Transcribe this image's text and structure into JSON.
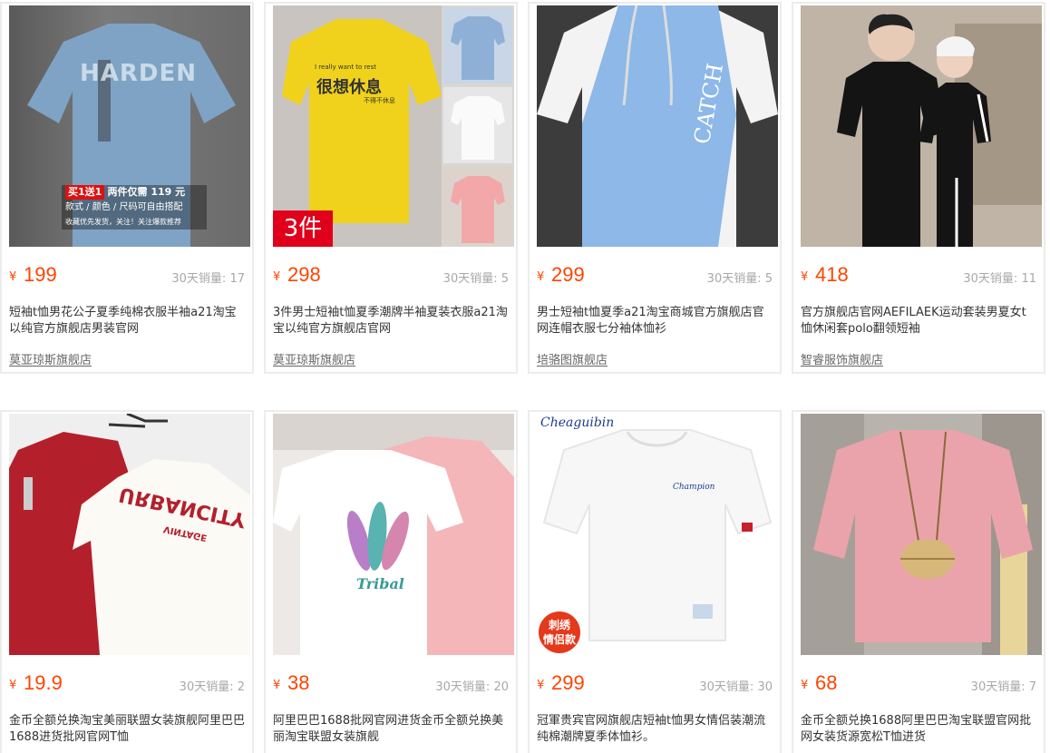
{
  "currency": "¥",
  "products": [
    {
      "price": "199",
      "sales": "30天销量: 17",
      "title": "短袖t恤男花公子夏季纯棉衣服半袖a21淘宝以纯官方旗舰店男装官网",
      "shop": "莫亚琼斯旗舰店"
    },
    {
      "price": "298",
      "sales": "30天销量: 5",
      "title": "3件男士短袖t恤夏季潮牌半袖夏装衣服a21淘宝以纯官方旗舰店官网",
      "shop": "莫亚琼斯旗舰店"
    },
    {
      "price": "299",
      "sales": "30天销量: 5",
      "title": "男士短袖t恤夏季a21淘宝商城官方旗舰店官网连帽衣服七分袖体恤衫",
      "shop": "培骆图旗舰店"
    },
    {
      "price": "418",
      "sales": "30天销量: 11",
      "title": "官方旗舰店官网AEFILAEK运动套装男夏女t恤休闲套polo翻领短袖",
      "shop": "智睿服饰旗舰店"
    },
    {
      "price": "19.9",
      "sales": "30天销量: 2",
      "title": "金币全额兑换淘宝美丽联盟女装旗舰阿里巴巴1688进货批网官网T恤",
      "shop": ""
    },
    {
      "price": "38",
      "sales": "30天销量: 20",
      "title": "阿里巴巴1688批网官网进货金币全额兑换美丽淘宝联盟女装旗舰",
      "shop": ""
    },
    {
      "price": "299",
      "sales": "30天销量: 30",
      "title": "冠軍贵宾官网旗舰店短袖t恤男女情侣装潮流纯棉潮牌夏季体恤衫。",
      "shop": ""
    },
    {
      "price": "68",
      "sales": "30天销量: 7",
      "title": "金币全额兑换1688阿里巴巴淘宝联盟官网批网女装货源宽松T恤进货",
      "shop": ""
    }
  ],
  "overlays": {
    "p1_promo_line1_hl": "买1送1",
    "p1_promo_line1": "两件仅需 119 元",
    "p1_promo_line2": "款式 / 颜色 / 尺码可自由搭配",
    "p1_promo_line3": "收藏优先发货，关注！关注爆款推荐",
    "p1_shirt_text": "HARDEN",
    "p2_badge": "3件",
    "p2_shirt_small": "I really want to rest",
    "p2_shirt_big": "很想休息",
    "p2_shirt_sub": "不得不休息",
    "p3_shirt_text": "CATCH",
    "p5_shirt_text": "URBANCITY",
    "p5_shirt_sub": "VINTAGE",
    "p6_shirt_text": "Tribal",
    "p7_logo": "Cheaguibin",
    "p7_chest": "Champion",
    "p7_badge_l1": "刺绣",
    "p7_badge_l2": "情侣款"
  }
}
